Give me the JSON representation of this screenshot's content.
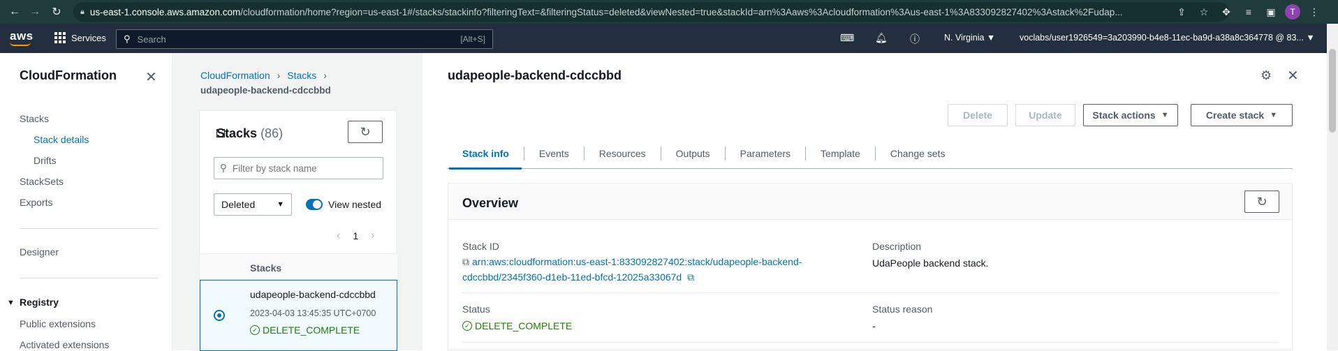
{
  "browser": {
    "url_host": "us-east-1.console.aws.amazon.com",
    "url_path": "/cloudformation/home?region=us-east-1#/stacks/stackinfo?filteringText=&filteringStatus=deleted&viewNested=true&stackId=arn%3Aaws%3Acloudformation%3Aus-east-1%3A833092827402%3Astack%2Fudap...",
    "avatar_letter": "T"
  },
  "topnav": {
    "logo": "aws",
    "services_label": "Services",
    "search_placeholder": "Search",
    "search_shortcut": "[Alt+S]",
    "region": "N. Virginia ▼",
    "account": "voclabs/user1926549=3a203990-b4e8-11ec-ba9d-a38a8c364778 @ 83... ▼"
  },
  "sidebar": {
    "title": "CloudFormation",
    "items": [
      {
        "label": "Stacks"
      },
      {
        "label": "Stack details"
      },
      {
        "label": "Drifts"
      },
      {
        "label": "StackSets"
      },
      {
        "label": "Exports"
      },
      {
        "label": "Designer"
      },
      {
        "label": "Registry"
      },
      {
        "label": "Public extensions"
      },
      {
        "label": "Activated extensions"
      }
    ]
  },
  "breadcrumb": {
    "items": [
      "CloudFormation",
      "Stacks"
    ],
    "current": "udapeople-backend-cdccbbd"
  },
  "stacks_panel": {
    "title": "Stacks",
    "count": "(86)",
    "filter_placeholder": "Filter by stack name",
    "status_filter": "Deleted",
    "view_nested_label": "View nested",
    "page": "1",
    "column_header": "Stacks",
    "rows": [
      {
        "name": "udapeople-backend-cdccbbd",
        "date": "2023-04-03 13:45:35 UTC+0700",
        "status": "DELETE_COMPLETE"
      }
    ]
  },
  "detail": {
    "title": "udapeople-backend-cdccbbd",
    "buttons": {
      "delete": "Delete",
      "update": "Update",
      "stack_actions": "Stack actions",
      "create_stack": "Create stack"
    },
    "tabs": [
      "Stack info",
      "Events",
      "Resources",
      "Outputs",
      "Parameters",
      "Template",
      "Change sets"
    ],
    "overview": {
      "title": "Overview",
      "stack_id_label": "Stack ID",
      "stack_id_line1": "arn:aws:cloudformation:us-east-1:833092827402:stack/udapeople-backend-",
      "stack_id_line2": "cdccbbd/2345f360-d1eb-11ed-bfcd-12025a33067d",
      "description_label": "Description",
      "description": "UdaPeople backend stack.",
      "status_label": "Status",
      "status": "DELETE_COMPLETE",
      "status_reason_label": "Status reason",
      "status_reason": "-"
    }
  },
  "colors": {
    "link": "#0073bb",
    "success": "#1d8102",
    "aws_nav": "#232f3e",
    "browser_bar": "#1f3b3b"
  }
}
